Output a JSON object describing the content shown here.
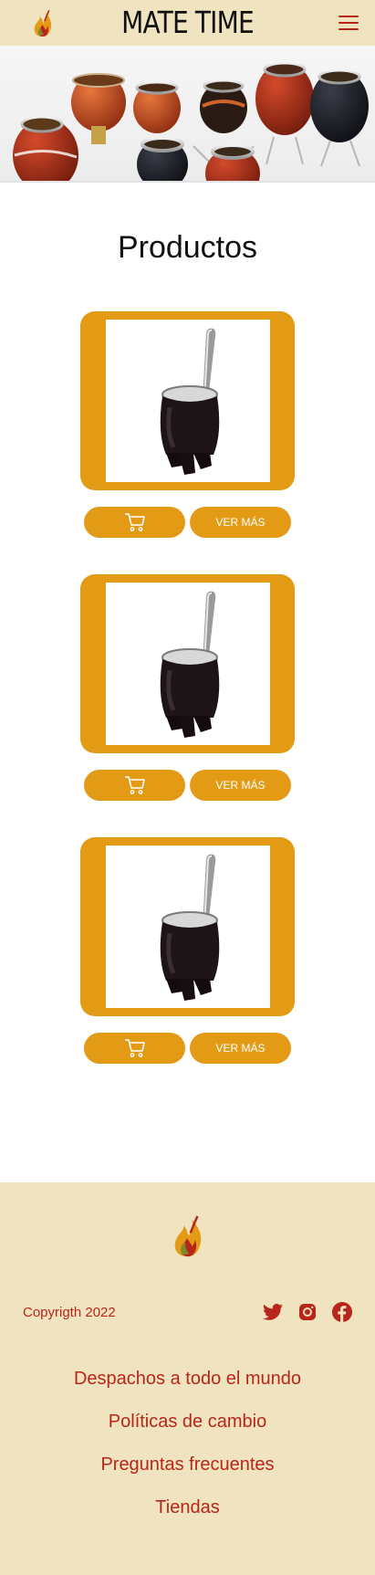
{
  "header": {
    "title": "MATE TIME",
    "logo_icon": "mate-flame-logo-icon",
    "menu_icon": "hamburger-menu-icon"
  },
  "hero": {
    "image": "mate-gourds-collection"
  },
  "main": {
    "title": "Productos",
    "products": [
      {
        "image": "black-mate-gourd-with-bombilla",
        "cart_icon": "shopping-cart-icon",
        "more_label": "VER MÁS"
      },
      {
        "image": "black-mate-gourd-with-bombilla",
        "cart_icon": "shopping-cart-icon",
        "more_label": "VER MÁS"
      },
      {
        "image": "black-mate-gourd-with-bombilla",
        "cart_icon": "shopping-cart-icon",
        "more_label": "VER MÁS"
      }
    ]
  },
  "footer": {
    "copyright": "Copyrigth 2022",
    "socials": [
      "twitter-icon",
      "instagram-icon",
      "facebook-icon"
    ],
    "links": [
      "Despachos a todo el mundo",
      "Políticas de cambio",
      "Preguntas frecuentes",
      "Tiendas"
    ]
  },
  "colors": {
    "cream": "#f0e3c0",
    "orange": "#e39b16",
    "red": "#b8261b"
  }
}
